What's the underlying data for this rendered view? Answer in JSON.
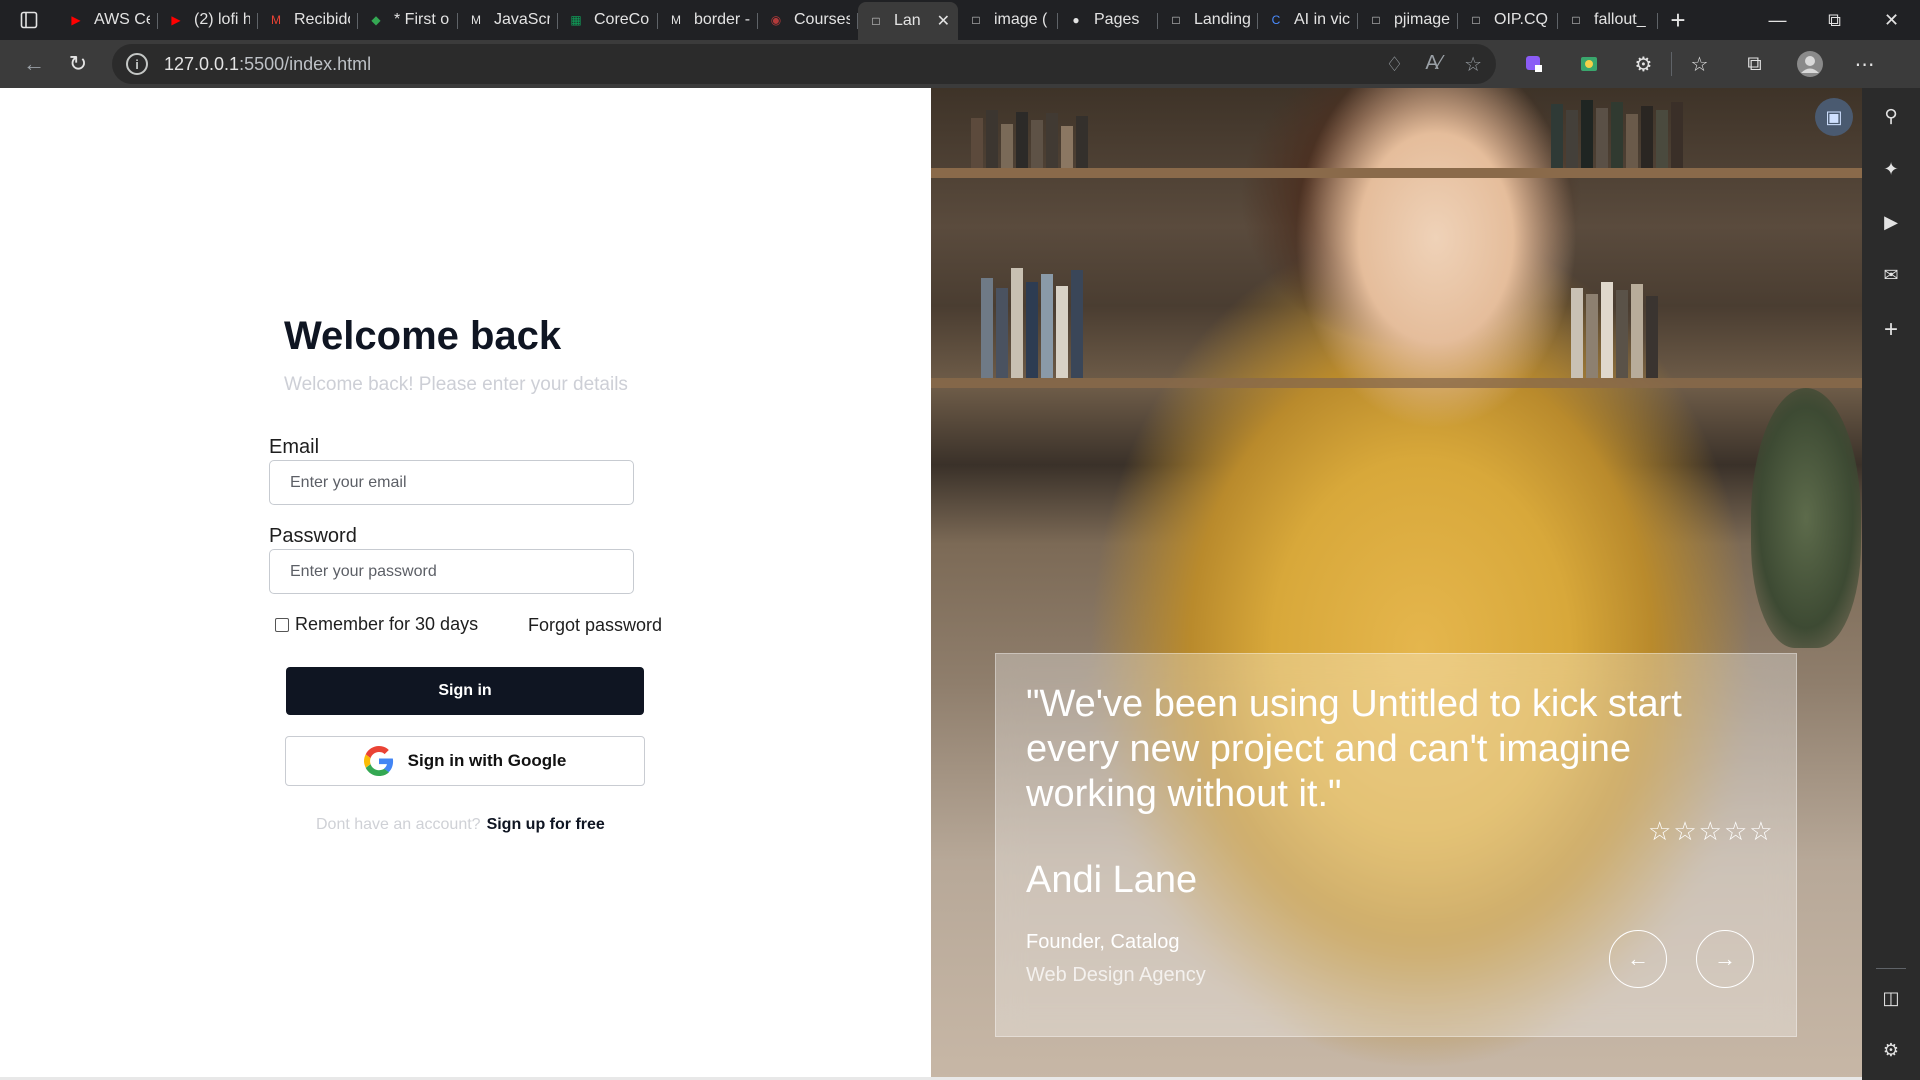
{
  "browser": {
    "tabs": [
      {
        "title": "AWS Ce",
        "favicon": "youtube-icon",
        "color": "#ff0000"
      },
      {
        "title": "(2) lofi h",
        "favicon": "youtube-icon",
        "color": "#ff0000"
      },
      {
        "title": "Recibido",
        "favicon": "gmail-icon",
        "color": "#ea4335"
      },
      {
        "title": "* First o",
        "favicon": "shield-icon",
        "color": "#34a853"
      },
      {
        "title": "JavaScri",
        "favicon": "mdn-icon",
        "color": "#e3e3e3"
      },
      {
        "title": "CoreCou",
        "favicon": "sheet-icon",
        "color": "#0f9d58"
      },
      {
        "title": "border -",
        "favicon": "mdn-icon",
        "color": "#e3e3e3"
      },
      {
        "title": "Courses",
        "favicon": "course-icon",
        "color": "#b23a3a"
      },
      {
        "title": "Lan",
        "favicon": "page-icon",
        "color": "#e3e3e3",
        "active": true
      },
      {
        "title": "image (",
        "favicon": "page-icon",
        "color": "#e3e3e3"
      },
      {
        "title": "Pages",
        "favicon": "github-icon",
        "color": "#e3e3e3"
      },
      {
        "title": "Landing",
        "favicon": "page-icon",
        "color": "#e3e3e3"
      },
      {
        "title": "AI in vic",
        "favicon": "copilot-icon",
        "color": "#4a8cff"
      },
      {
        "title": "pjimage",
        "favicon": "page-icon",
        "color": "#e3e3e3"
      },
      {
        "title": "OIP.CQ",
        "favicon": "page-icon",
        "color": "#e3e3e3"
      },
      {
        "title": "fallout_",
        "favicon": "page-icon",
        "color": "#e3e3e3"
      }
    ],
    "url_host": "127.0.0.1",
    "url_path": ":5500/index.html"
  },
  "login": {
    "title": "Welcome back",
    "subtitle": "Welcome back! Please enter your details",
    "email_label": "Email",
    "email_placeholder": "Enter your email",
    "password_label": "Password",
    "password_placeholder": "Enter your password",
    "remember_label": "Remember for 30 days",
    "forgot_label": "Forgot password",
    "signin_label": "Sign in",
    "google_label": "Sign in with Google",
    "no_account_text": "Dont have an account?",
    "signup_label": "Sign up for free"
  },
  "testimonial": {
    "quote": "\"We've been using Untitled to kick start every new project and can't imagine working without it.\"",
    "rating": 0,
    "rating_max": 5,
    "name": "Andi Lane",
    "role": "Founder, Catalog",
    "company": "Web Design Agency"
  },
  "colors": {
    "primary": "#0f1522",
    "muted_text": "#cdcfd6",
    "browser_dark": "#202124",
    "toolbar": "#3b3b3b"
  }
}
